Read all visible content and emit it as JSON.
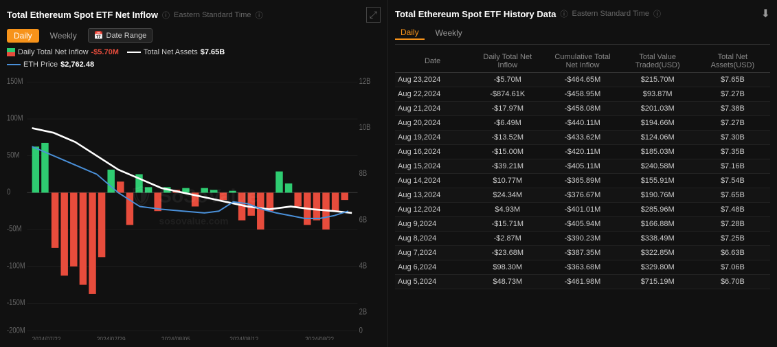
{
  "left": {
    "title": "Total Ethereum Spot ETF Net Inflow",
    "timezone": "Eastern Standard Time",
    "tabs": [
      "Daily",
      "Weekly"
    ],
    "active_tab": "Daily",
    "date_range_label": "Date Range",
    "legend": {
      "inflow_label": "Daily Total Net Inflow",
      "inflow_value": "-$5.70M",
      "assets_label": "Total Net Assets",
      "assets_value": "$7.65B",
      "eth_label": "ETH Price",
      "eth_value": "$2,762.48"
    },
    "y_left": [
      "150M",
      "100M",
      "50M",
      "0",
      "−50M",
      "−100M",
      "−150M",
      "−200M"
    ],
    "y_right": [
      "12B",
      "10B",
      "8B",
      "6B",
      "4B",
      "2B",
      "0"
    ],
    "x_labels": [
      "2024/07/22",
      "2024/07/29",
      "2024/08/05",
      "2024/08/12",
      "2024/08/22"
    ]
  },
  "right": {
    "title": "Total Ethereum Spot ETF History Data",
    "timezone": "Eastern Standard Time",
    "tabs": [
      "Daily",
      "Weekly"
    ],
    "active_tab": "Daily",
    "columns": [
      "Date",
      "Daily Total Net Inflow",
      "Cumulative Total Net Inflow",
      "Total Value Traded(USD)",
      "Total Net Assets(USD)"
    ],
    "rows": [
      {
        "date": "Aug 23,2024",
        "inflow": "-$5.70M",
        "cumulative": "-$464.65M",
        "traded": "$215.70M",
        "assets": "$7.65B",
        "inflow_neg": true
      },
      {
        "date": "Aug 22,2024",
        "inflow": "-$874.61K",
        "cumulative": "-$458.95M",
        "traded": "$93.87M",
        "assets": "$7.27B",
        "inflow_neg": true
      },
      {
        "date": "Aug 21,2024",
        "inflow": "-$17.97M",
        "cumulative": "-$458.08M",
        "traded": "$201.03M",
        "assets": "$7.38B",
        "inflow_neg": true
      },
      {
        "date": "Aug 20,2024",
        "inflow": "-$6.49M",
        "cumulative": "-$440.11M",
        "traded": "$194.66M",
        "assets": "$7.27B",
        "inflow_neg": true
      },
      {
        "date": "Aug 19,2024",
        "inflow": "-$13.52M",
        "cumulative": "-$433.62M",
        "traded": "$124.06M",
        "assets": "$7.30B",
        "inflow_neg": true
      },
      {
        "date": "Aug 16,2024",
        "inflow": "-$15.00M",
        "cumulative": "-$420.11M",
        "traded": "$185.03M",
        "assets": "$7.35B",
        "inflow_neg": true
      },
      {
        "date": "Aug 15,2024",
        "inflow": "-$39.21M",
        "cumulative": "-$405.11M",
        "traded": "$240.58M",
        "assets": "$7.16B",
        "inflow_neg": true
      },
      {
        "date": "Aug 14,2024",
        "inflow": "$10.77M",
        "cumulative": "-$365.89M",
        "traded": "$155.91M",
        "assets": "$7.54B",
        "inflow_neg": false
      },
      {
        "date": "Aug 13,2024",
        "inflow": "$24.34M",
        "cumulative": "-$376.67M",
        "traded": "$190.76M",
        "assets": "$7.65B",
        "inflow_neg": false
      },
      {
        "date": "Aug 12,2024",
        "inflow": "$4.93M",
        "cumulative": "-$401.01M",
        "traded": "$285.96M",
        "assets": "$7.48B",
        "inflow_neg": false
      },
      {
        "date": "Aug 9,2024",
        "inflow": "-$15.71M",
        "cumulative": "-$405.94M",
        "traded": "$166.88M",
        "assets": "$7.28B",
        "inflow_neg": true
      },
      {
        "date": "Aug 8,2024",
        "inflow": "-$2.87M",
        "cumulative": "-$390.23M",
        "traded": "$338.49M",
        "assets": "$7.25B",
        "inflow_neg": true
      },
      {
        "date": "Aug 7,2024",
        "inflow": "-$23.68M",
        "cumulative": "-$387.35M",
        "traded": "$322.85M",
        "assets": "$6.63B",
        "inflow_neg": true
      },
      {
        "date": "Aug 6,2024",
        "inflow": "$98.30M",
        "cumulative": "-$363.68M",
        "traded": "$329.80M",
        "assets": "$7.06B",
        "inflow_neg": false
      },
      {
        "date": "Aug 5,2024",
        "inflow": "$48.73M",
        "cumulative": "-$461.98M",
        "traded": "$715.19M",
        "assets": "$6.70B",
        "inflow_neg": false
      }
    ]
  }
}
